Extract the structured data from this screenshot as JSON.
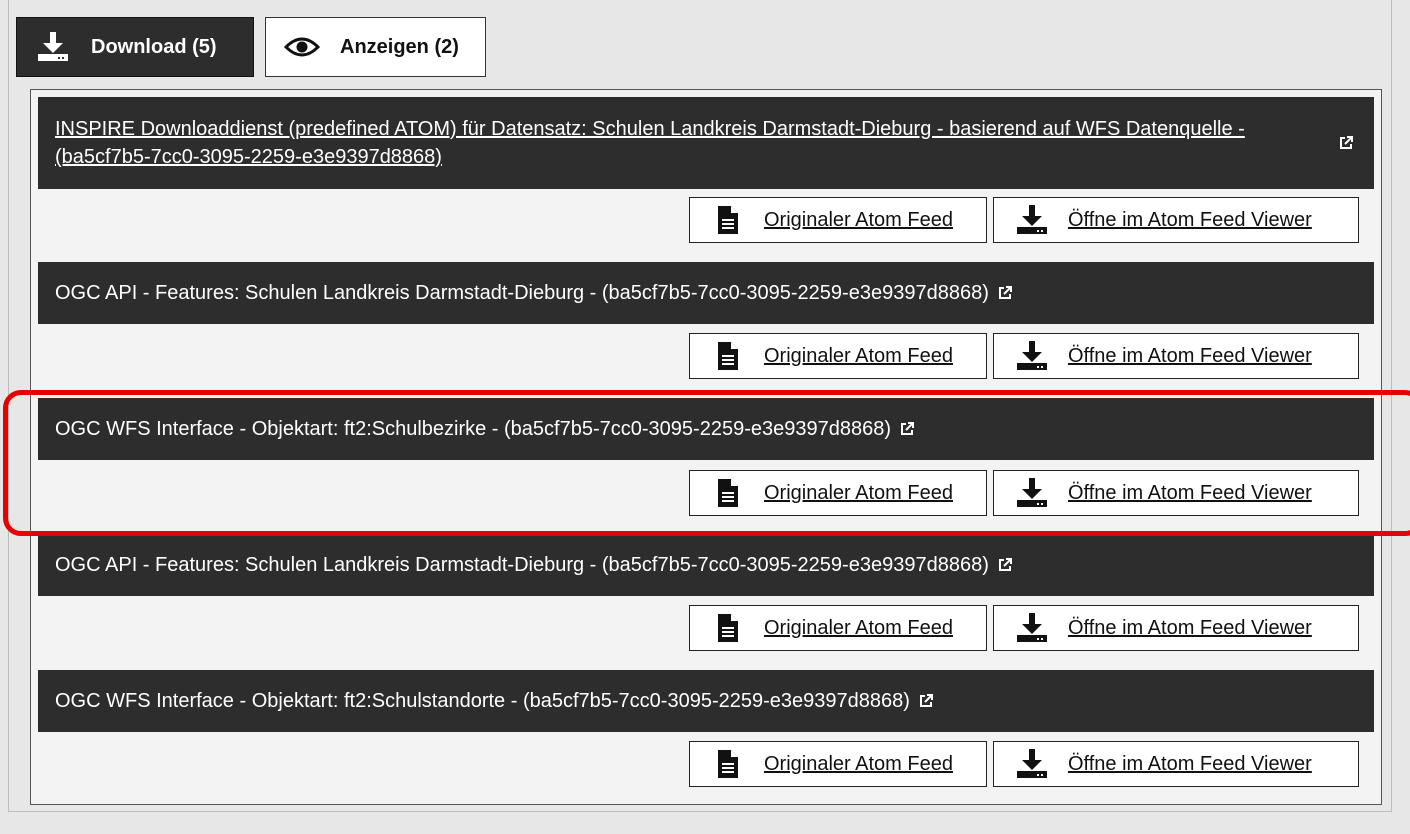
{
  "tabs": [
    {
      "label": "Download (5)",
      "icon": "download-icon",
      "active": true
    },
    {
      "label": "Anzeigen (2)",
      "icon": "eye-icon",
      "active": false
    }
  ],
  "entries": [
    {
      "title": "INSPIRE Downloaddienst (predefined ATOM) für Datensatz: Schulen Landkreis Darmstadt-Dieburg - basierend auf WFS Datenquelle - (ba5cf7b5-7cc0-3095-2259-e3e9397d8868)",
      "linked": true
    },
    {
      "title": "OGC API - Features: Schulen Landkreis Darmstadt-Dieburg - (ba5cf7b5-7cc0-3095-2259-e3e9397d8868)",
      "linked": false
    },
    {
      "title": "OGC WFS Interface - Objektart: ft2:Schulbezirke - (ba5cf7b5-7cc0-3095-2259-e3e9397d8868)",
      "linked": false,
      "highlighted": true
    },
    {
      "title": "OGC API - Features: Schulen Landkreis Darmstadt-Dieburg - (ba5cf7b5-7cc0-3095-2259-e3e9397d8868)",
      "linked": false
    },
    {
      "title": "OGC WFS Interface - Objektart: ft2:Schulstandorte - (ba5cf7b5-7cc0-3095-2259-e3e9397d8868)",
      "linked": false
    }
  ],
  "buttons": {
    "original_feed": "Originaler Atom Feed",
    "open_viewer": "Öffne im Atom Feed Viewer"
  },
  "colors": {
    "header_bg": "#2d2d2d",
    "highlight": "#e80000",
    "page_bg": "#e7e7e7"
  }
}
